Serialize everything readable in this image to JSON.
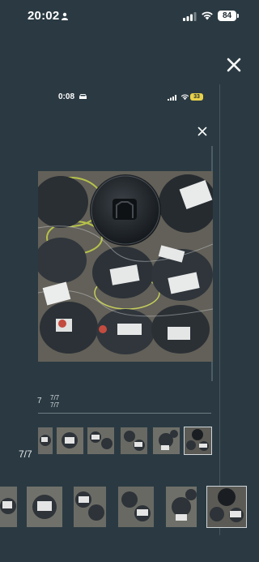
{
  "status_bar": {
    "time": "20:02",
    "battery": "84",
    "icons": [
      "person-icon",
      "signal-icon",
      "wifi-icon",
      "battery-icon"
    ]
  },
  "inner_status_bar": {
    "time": "0:08",
    "battery": "33",
    "icons": [
      "car-icon",
      "signal-icon",
      "wifi-icon",
      "battery-icon"
    ]
  },
  "viewer": {
    "counter": "7/7",
    "inner_counter_left": "7",
    "inner_counter_right_top": "7/7",
    "inner_counter_right_bottom": "7/7",
    "close_icon": "close-icon"
  },
  "colors": {
    "background": "#2b3a42",
    "battery_outer": "#ffffff",
    "battery_inner": "#e9d24a"
  }
}
